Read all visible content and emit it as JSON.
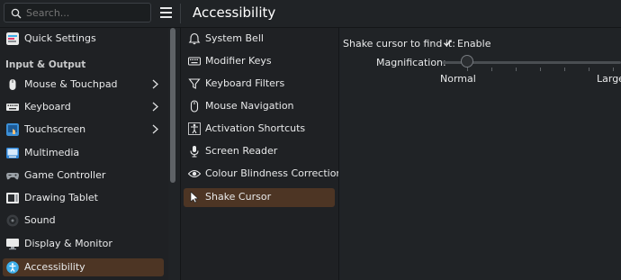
{
  "header": {
    "search_placeholder": "Search...",
    "title": "Accessibility"
  },
  "sidebar": {
    "quick_settings": "Quick Settings",
    "section_label": "Input & Output",
    "items": [
      {
        "label": "Mouse & Touchpad",
        "icon": "mouse-icon",
        "has_children": true
      },
      {
        "label": "Keyboard",
        "icon": "keyboard-icon",
        "has_children": true
      },
      {
        "label": "Touchscreen",
        "icon": "touchscreen-icon",
        "has_children": true
      },
      {
        "label": "Multimedia",
        "icon": "multimedia-icon",
        "has_children": false
      },
      {
        "label": "Game Controller",
        "icon": "game-controller-icon",
        "has_children": false
      },
      {
        "label": "Drawing Tablet",
        "icon": "drawing-tablet-icon",
        "has_children": false
      },
      {
        "label": "Sound",
        "icon": "sound-icon",
        "has_children": false
      },
      {
        "label": "Display & Monitor",
        "icon": "display-icon",
        "has_children": false
      },
      {
        "label": "Accessibility",
        "icon": "accessibility-icon",
        "has_children": false,
        "active": true
      }
    ]
  },
  "submenu": {
    "items": [
      {
        "label": "System Bell",
        "icon": "bell-icon"
      },
      {
        "label": "Modifier Keys",
        "icon": "keyboard-icon"
      },
      {
        "label": "Keyboard Filters",
        "icon": "filter-icon"
      },
      {
        "label": "Mouse Navigation",
        "icon": "mouse-icon"
      },
      {
        "label": "Activation Shortcuts",
        "icon": "shortcut-icon"
      },
      {
        "label": "Screen Reader",
        "icon": "microphone-icon"
      },
      {
        "label": "Colour Blindness Correction",
        "icon": "eye-icon"
      },
      {
        "label": "Shake Cursor",
        "icon": "cursor-icon",
        "active": true
      }
    ]
  },
  "content": {
    "shake_label": "Shake cursor to find it:",
    "enable_label": "Enable",
    "enabled": true,
    "magnification_label": "Magnification:",
    "slider_min_label": "Normal",
    "slider_max_label": "Large",
    "magnification_level": 0.0
  },
  "colors": {
    "accent_selection": "#4d3524",
    "background": "#202326",
    "panel": "#1f2124",
    "text": "#e8e9ea"
  }
}
